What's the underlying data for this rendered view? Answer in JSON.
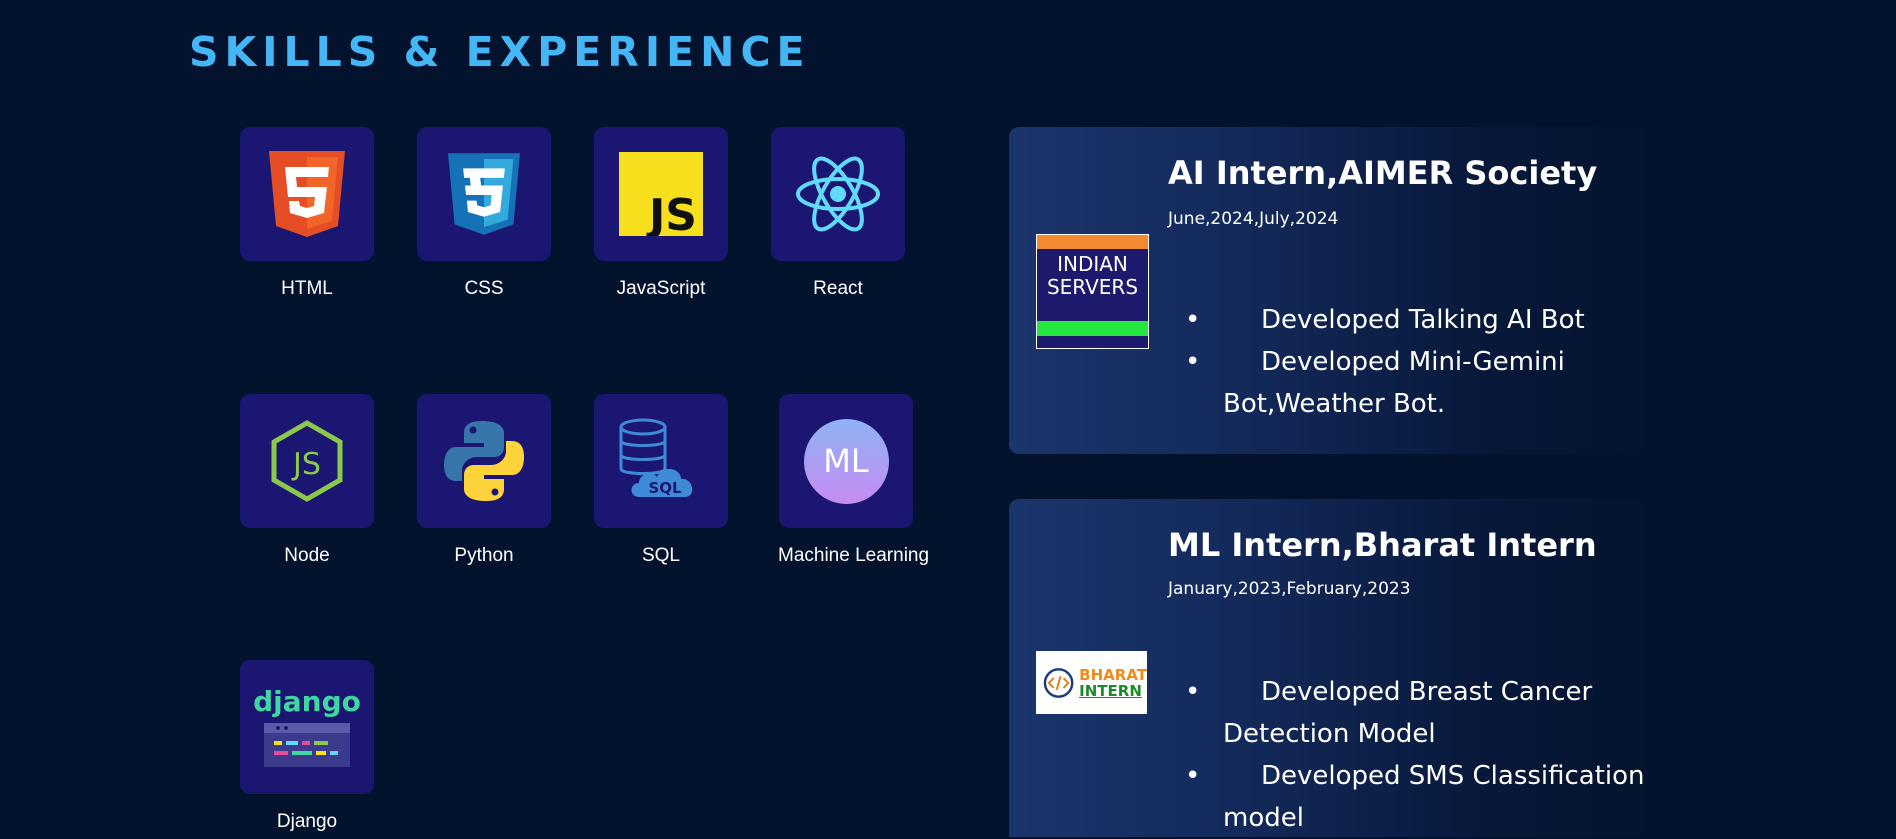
{
  "section": {
    "title": "SKILLS & EXPERIENCE"
  },
  "skills": [
    {
      "label": "HTML",
      "icon": "html5-icon"
    },
    {
      "label": "CSS",
      "icon": "css3-icon"
    },
    {
      "label": "JavaScript",
      "icon": "javascript-icon"
    },
    {
      "label": "React",
      "icon": "react-icon"
    },
    {
      "label": "Node",
      "icon": "nodejs-icon"
    },
    {
      "label": "Python",
      "icon": "python-icon"
    },
    {
      "label": "SQL",
      "icon": "sql-database-icon"
    },
    {
      "label": "Machine Learning",
      "icon": "machine-learning-icon",
      "badge": "ML"
    },
    {
      "label": "Django",
      "icon": "django-icon",
      "wordmark": "django"
    }
  ],
  "experience": [
    {
      "role": "AI Intern,AIMER Society",
      "dates": "June,2024,July,2024",
      "logo_text": [
        "INDIAN",
        "SERVERS"
      ],
      "bullets": [
        "Developed Talking AI Bot",
        "Developed Mini-Gemini Bot,Weather Bot."
      ]
    },
    {
      "role": "ML Intern,Bharat Intern",
      "dates": "January,2023,February,2023",
      "logo_text": [
        "BHARAT",
        "INTERN"
      ],
      "bullets": [
        "Developed Breast Cancer Detection Model",
        "Developed SMS Classification model"
      ]
    }
  ],
  "colors": {
    "background": "#04132d",
    "title": "#45b6f5",
    "skill_tile": "#1a1672",
    "card_start": "#1b356d"
  }
}
